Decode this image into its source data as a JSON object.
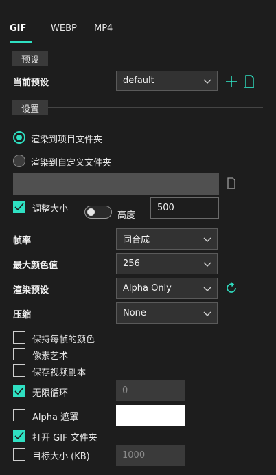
{
  "tabs": [
    {
      "label": "GIF",
      "active": true
    },
    {
      "label": "WEBP",
      "active": false
    },
    {
      "label": "MP4",
      "active": false
    }
  ],
  "presets_section": {
    "title": "预设"
  },
  "current_preset": {
    "label": "当前预设",
    "value": "default"
  },
  "settings_section": {
    "title": "设置"
  },
  "render_location": {
    "option_project": "渲染到项目文件夹",
    "option_custom": "渲染到自定义文件夹",
    "selected": "option_project",
    "custom_path_value": ""
  },
  "resize": {
    "label": "调整大小",
    "checked": true,
    "height_label": "高度",
    "height_value": "500",
    "toggle_on": false
  },
  "framerate": {
    "label": "帧率",
    "value": "同合成"
  },
  "max_colors": {
    "label": "最大颜色值",
    "value": "256"
  },
  "render_preset": {
    "label": "渲染预设",
    "value": "Alpha Only"
  },
  "compression": {
    "label": "压缩",
    "value": "None"
  },
  "options": {
    "keep_frame_colors": {
      "label": "保持每帧的颜色",
      "checked": false
    },
    "pixel_art": {
      "label": "像素艺术",
      "checked": false
    },
    "save_video_copy": {
      "label": "保存视频副本",
      "checked": false
    },
    "infinite_loop": {
      "label": "无限循环",
      "checked": true,
      "value": "0"
    },
    "alpha_matte": {
      "label": "Alpha 遮罩",
      "checked": false,
      "color": "#ffffff"
    },
    "open_gif_folder": {
      "label": "打开 GIF 文件夹",
      "checked": true
    },
    "target_size": {
      "label": "目标大小 (KB)",
      "checked": false,
      "value": "1000"
    }
  },
  "colors": {
    "accent": "#2fe0c2",
    "background": "#1d1d1d",
    "field": "#323232"
  },
  "icons": [
    "plus-icon",
    "document-icon",
    "folder-icon",
    "refresh-icon",
    "chevron-down-icon",
    "checkmark-icon"
  ]
}
